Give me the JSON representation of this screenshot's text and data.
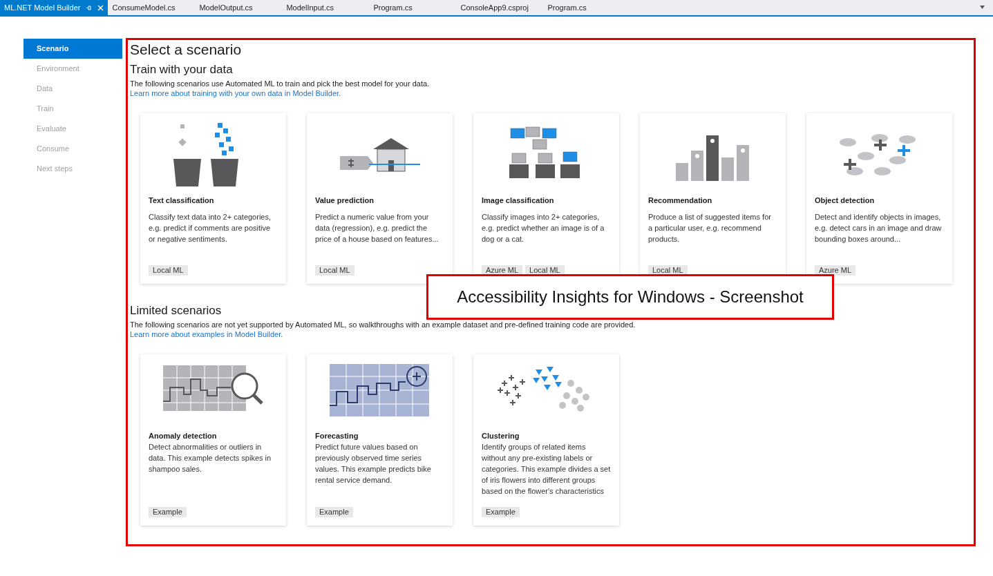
{
  "tabs": [
    {
      "label": "ML.NET Model Builder",
      "selected": true
    },
    {
      "label": "ConsumeModel.cs",
      "selected": false
    },
    {
      "label": "ModelOutput.cs",
      "selected": false
    },
    {
      "label": "ModelInput.cs",
      "selected": false
    },
    {
      "label": "Program.cs",
      "selected": false
    },
    {
      "label": "ConsoleApp9.csproj",
      "selected": false
    },
    {
      "label": "Program.cs",
      "selected": false
    }
  ],
  "sidebar": {
    "items": [
      {
        "label": "Scenario",
        "selected": true
      },
      {
        "label": "Environment",
        "selected": false
      },
      {
        "label": "Data",
        "selected": false
      },
      {
        "label": "Train",
        "selected": false
      },
      {
        "label": "Evaluate",
        "selected": false
      },
      {
        "label": "Consume",
        "selected": false
      },
      {
        "label": "Next steps",
        "selected": false
      }
    ]
  },
  "title": "Select a scenario",
  "sections": [
    {
      "heading": "Train with your data",
      "description": "The following scenarios use Automated ML to train and pick the best model for your data.",
      "link": "Learn more about training with your own data in Model Builder.",
      "cards": [
        {
          "kind": "text",
          "title": "Text classification",
          "description": "Classify text data into 2+ categories, e.g. predict if comments are positive or negative sentiments.",
          "tags": [
            "Local ML"
          ]
        },
        {
          "kind": "value",
          "title": "Value prediction",
          "description": "Predict a numeric value from your data (regression), e.g. predict the price of a house based on features...",
          "tags": [
            "Local ML"
          ]
        },
        {
          "kind": "image",
          "title": "Image classification",
          "description": "Classify images into 2+ categories, e.g. predict whether an image is of a dog or a cat.",
          "tags": [
            "Azure ML",
            "Local ML"
          ]
        },
        {
          "kind": "recommendation",
          "title": "Recommendation",
          "description": "Produce a list of suggested items for a particular user, e.g. recommend products.",
          "tags": [
            "Local ML"
          ]
        },
        {
          "kind": "object",
          "title": "Object detection",
          "description": "Detect and identify objects in images, e.g. detect cars in an image and draw bounding boxes around...",
          "tags": [
            "Azure ML"
          ]
        }
      ]
    },
    {
      "heading": "Limited scenarios",
      "description": "The following scenarios are not yet supported by Automated ML, so walkthroughs with an example dataset and pre-defined training code are provided.",
      "link": "Learn more about examples in Model Builder.",
      "cards": [
        {
          "kind": "anomaly",
          "title": "Anomaly detection",
          "description": "Detect abnormalities or outliers in data. This example detects spikes in shampoo sales.",
          "tags": [
            "Example"
          ]
        },
        {
          "kind": "forecasting",
          "title": "Forecasting",
          "description": "Predict future values based on previously observed time series values. This example predicts bike rental service demand.",
          "tags": [
            "Example"
          ]
        },
        {
          "kind": "clustering",
          "title": "Clustering",
          "description": "Identify groups of related items without any pre-existing labels or categories. This example divides a set of iris flowers into different groups based on the flower's characteristics",
          "tags": [
            "Example"
          ]
        }
      ]
    }
  ],
  "overlay": {
    "label": "Accessibility Insights for Windows - Screenshot"
  }
}
